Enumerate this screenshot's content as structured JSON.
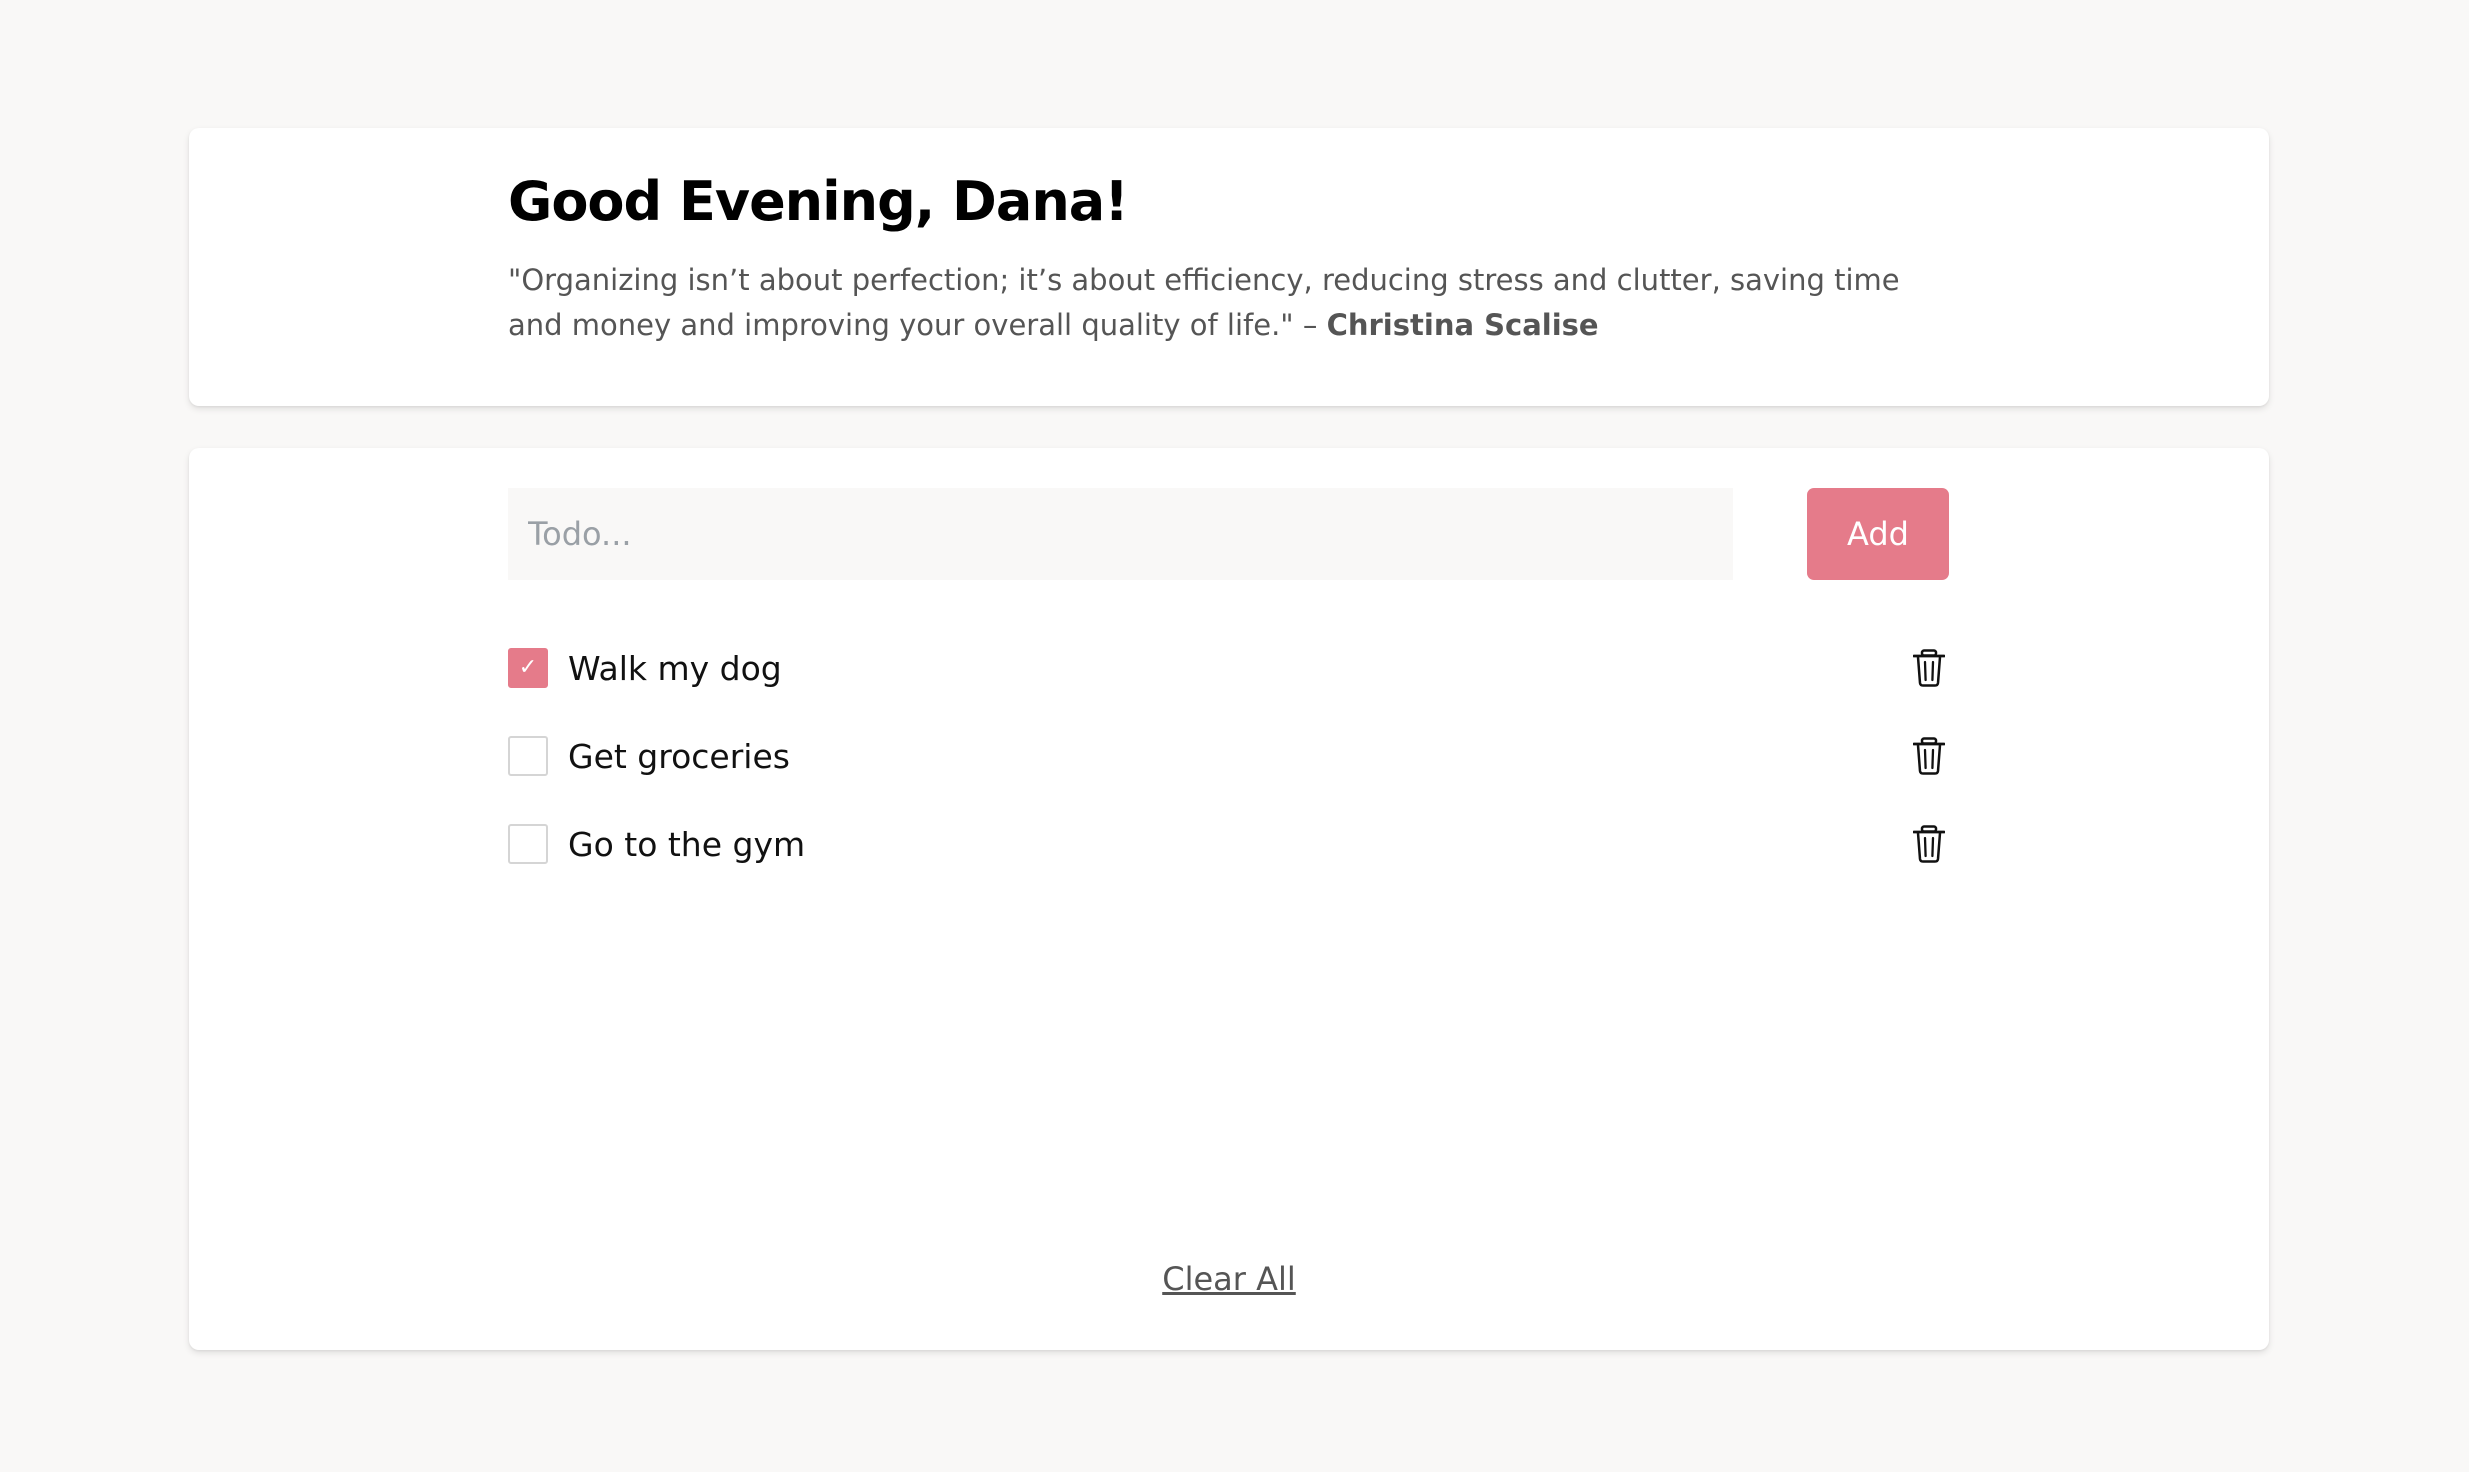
{
  "header": {
    "greeting": "Good Evening, Dana!",
    "quote_text": "\"Organizing isn’t about perfection; it’s about efficiency, reducing stress and clutter, saving time and money and improving your overall quality of life.\" –",
    "quote_author": "Christina Scalise"
  },
  "form": {
    "input_value": "",
    "input_placeholder": "Todo...",
    "add_label": "Add"
  },
  "todos": [
    {
      "label": "Walk my dog",
      "checked": true,
      "check_glyph": "✓",
      "delete_icon": "trash-icon"
    },
    {
      "label": "Get groceries",
      "checked": false,
      "check_glyph": "",
      "delete_icon": "trash-icon"
    },
    {
      "label": "Go to the gym",
      "checked": false,
      "check_glyph": "",
      "delete_icon": "trash-icon"
    }
  ],
  "footer": {
    "clear_all_label": "Clear All"
  },
  "colors": {
    "accent": "#e57b8a",
    "background": "#f9f8f7",
    "card": "#ffffff",
    "text_muted": "#555555"
  }
}
